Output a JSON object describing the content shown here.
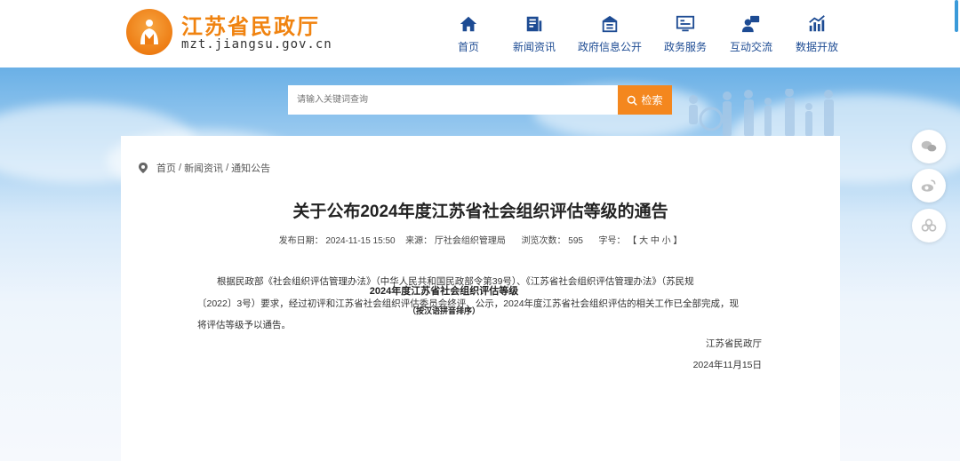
{
  "site": {
    "name": "江苏省民政厅",
    "domain": "mzt.jiangsu.gov.cn"
  },
  "nav": [
    {
      "label": "首页",
      "icon": "home-icon"
    },
    {
      "label": "新闻资讯",
      "icon": "news-icon"
    },
    {
      "label": "政府信息公开",
      "icon": "government-building-icon"
    },
    {
      "label": "政务服务",
      "icon": "monitor-icon"
    },
    {
      "label": "互动交流",
      "icon": "chat-user-icon"
    },
    {
      "label": "数据开放",
      "icon": "chart-icon"
    }
  ],
  "search": {
    "placeholder": "请输入关键词查询",
    "button_label": "检索"
  },
  "breadcrumb": {
    "home": "首页",
    "section": "新闻资讯",
    "current": "通知公告",
    "separator": "/"
  },
  "article": {
    "title": "关于公布2024年度江苏省社会组织评估等级的通告",
    "meta": {
      "date_label": "发布日期：",
      "date": "2024-11-15 15:50",
      "source_label": "来源：",
      "source": "厅社会组织管理局",
      "views_label": "浏览次数：",
      "views": "595",
      "font_label": "字号：",
      "font_open": "【",
      "font_large": "大",
      "font_medium": "中",
      "font_small": "小",
      "font_close": "】"
    },
    "paragraph_line1": "根据民政部《社会组织评估管理办法》（中华人民共和国民政部令第39号）、《江苏省社会组织评估管理办法》（苏民规",
    "paragraph_line2": "〔2022〕3号）要求，经过初评和江苏省社会组织评估委员会终评、公示，2024年度江苏省社会组织评估的相关工作已全部完成，现",
    "paragraph_line3": "将评估等级予以通告。",
    "signature_org": "江苏省民政厅",
    "signature_date": "2024年11月15日",
    "table_title": "2024年度江苏省社会组织评估等级",
    "table_subtitle": "（按汉语拼音排序）"
  },
  "share": [
    "wechat-icon",
    "weibo-icon",
    "share-circles-icon"
  ],
  "colors": {
    "brand_orange": "#f08310",
    "nav_blue": "#1d4b93",
    "search_button": "#f4871e"
  }
}
